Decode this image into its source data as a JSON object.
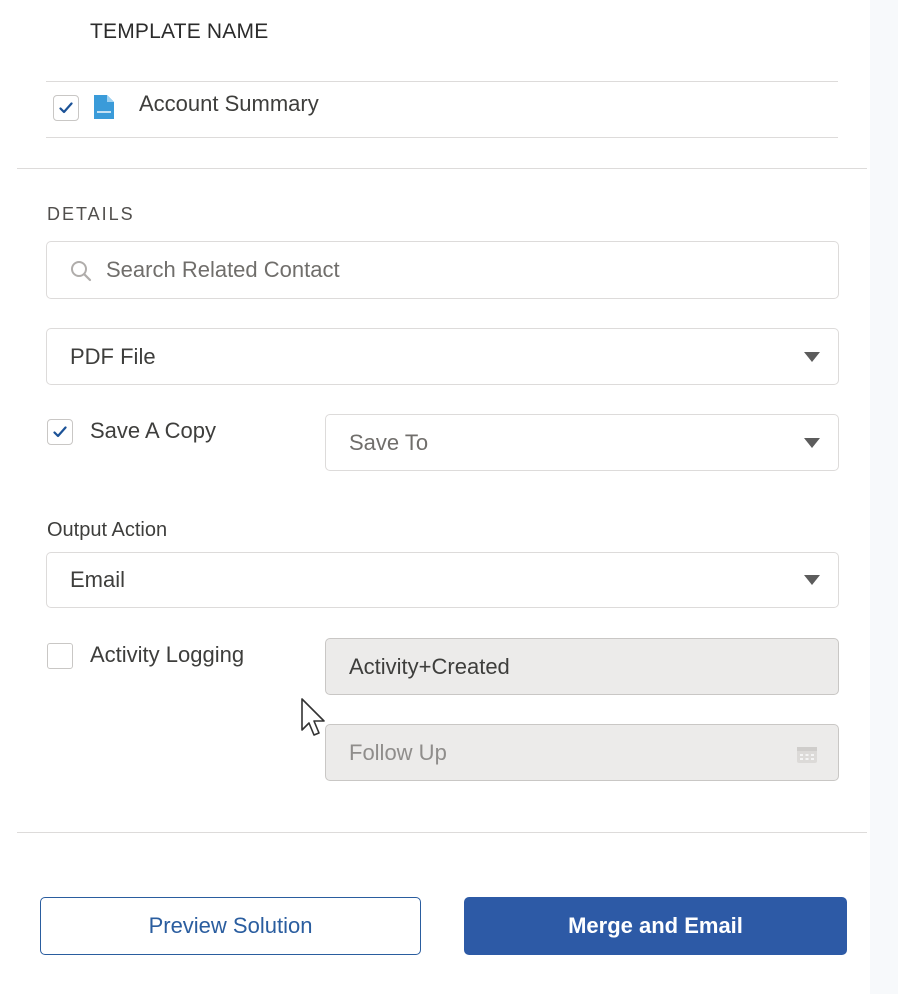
{
  "template": {
    "column_header": "TEMPLATE NAME",
    "row": {
      "checked": true,
      "icon": "doc-file-icon",
      "name": "Account Summary"
    }
  },
  "details": {
    "section_title": "DETAILS",
    "search": {
      "placeholder": "Search Related Contact",
      "icon": "search-icon"
    },
    "file_format": {
      "value": "PDF File"
    },
    "save_copy": {
      "checked": true,
      "label": "Save A Copy",
      "location_placeholder": "Save To"
    },
    "output_action": {
      "label": "Output Action",
      "value": "Email"
    },
    "activity_logging": {
      "checked": false,
      "label": "Activity Logging",
      "subject_value": "Activity+Created",
      "follow_up_placeholder": "Follow Up",
      "follow_up_icon": "calendar-icon"
    }
  },
  "footer": {
    "preview_label": "Preview Solution",
    "merge_label": "Merge and Email"
  },
  "colors": {
    "brand": "#2d5aa6",
    "border": "#dddbda",
    "check": "#1b5297"
  }
}
